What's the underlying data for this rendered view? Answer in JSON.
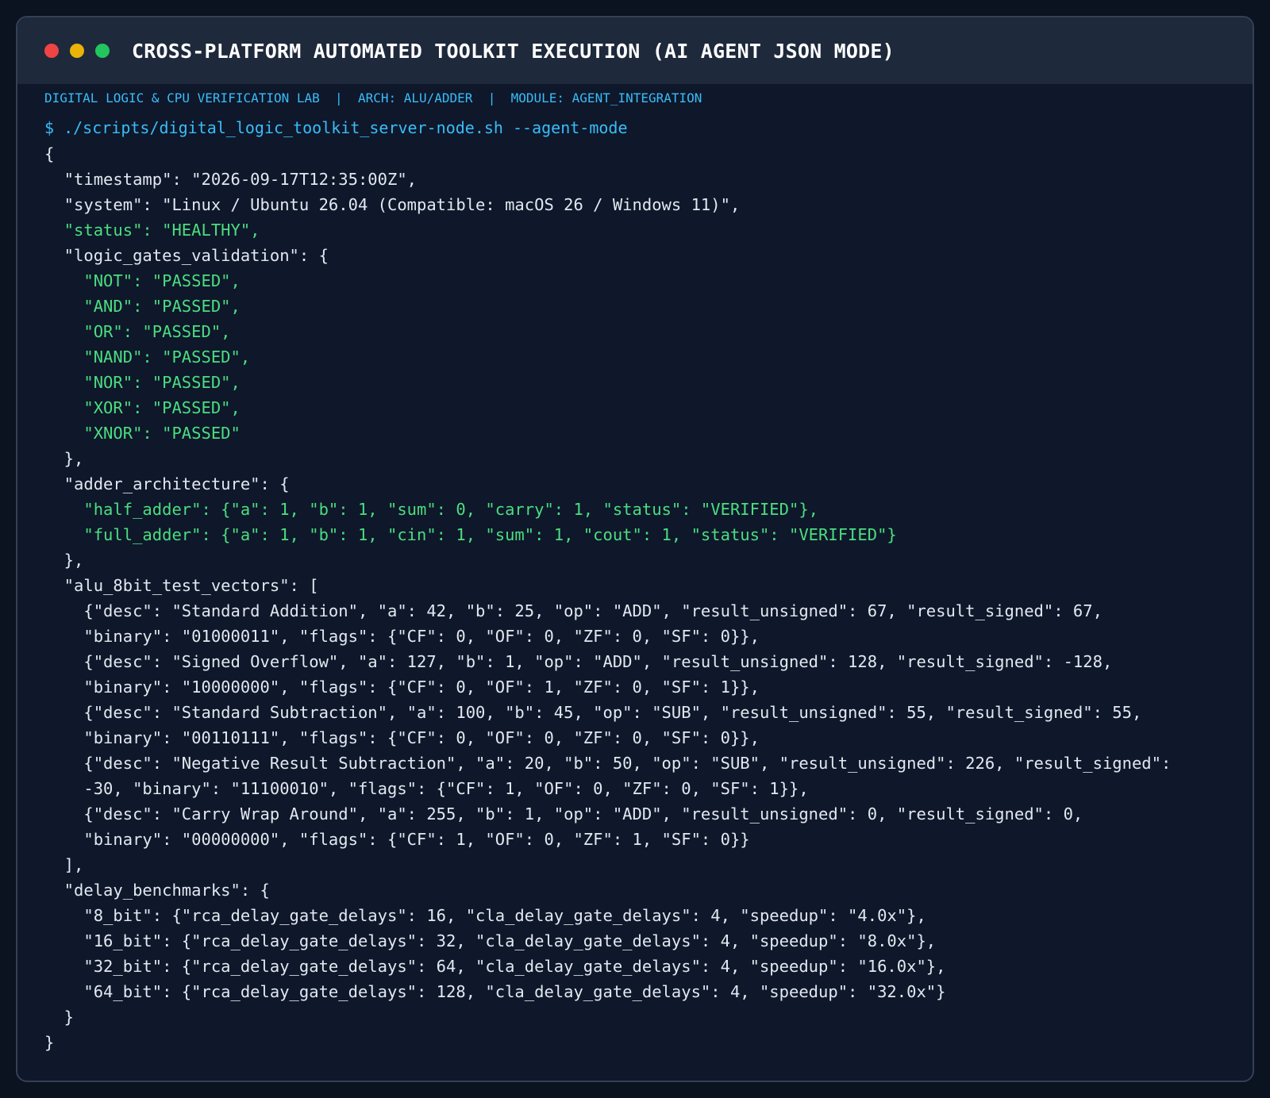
{
  "window": {
    "title": "CROSS-PLATFORM AUTOMATED TOOLKIT EXECUTION (AI AGENT JSON MODE)",
    "buttons": {
      "close_color": "#ef4444",
      "minimize_color": "#eab308",
      "maximize_color": "#22c55e"
    }
  },
  "meta_bar": "DIGITAL LOGIC & CPU VERIFICATION LAB  |  ARCH: ALU/ADDER  |  MODULE: AGENT_INTEGRATION",
  "command": "$ ./scripts/digital_logic_toolkit_server-node.sh --agent-mode",
  "colors": {
    "default_text": "#e2e8f0",
    "success_text": "#4ade80",
    "command_text": "#38bdf8"
  },
  "output_lines": [
    {
      "text": "{",
      "style": "default"
    },
    {
      "text": "  \"timestamp\": \"2026-09-17T12:35:00Z\",",
      "style": "default"
    },
    {
      "text": "  \"system\": \"Linux / Ubuntu 26.04 (Compatible: macOS 26 / Windows 11)\",",
      "style": "default"
    },
    {
      "text": "  \"status\": \"HEALTHY\",",
      "style": "success"
    },
    {
      "text": "  \"logic_gates_validation\": {",
      "style": "default"
    },
    {
      "text": "    \"NOT\": \"PASSED\",",
      "style": "success"
    },
    {
      "text": "    \"AND\": \"PASSED\",",
      "style": "success"
    },
    {
      "text": "    \"OR\": \"PASSED\",",
      "style": "success"
    },
    {
      "text": "    \"NAND\": \"PASSED\",",
      "style": "success"
    },
    {
      "text": "    \"NOR\": \"PASSED\",",
      "style": "success"
    },
    {
      "text": "    \"XOR\": \"PASSED\",",
      "style": "success"
    },
    {
      "text": "    \"XNOR\": \"PASSED\"",
      "style": "success"
    },
    {
      "text": "  },",
      "style": "default"
    },
    {
      "text": "  \"adder_architecture\": {",
      "style": "default"
    },
    {
      "text": "    \"half_adder\": {\"a\": 1, \"b\": 1, \"sum\": 0, \"carry\": 1, \"status\": \"VERIFIED\"},",
      "style": "success"
    },
    {
      "text": "    \"full_adder\": {\"a\": 1, \"b\": 1, \"cin\": 1, \"sum\": 1, \"cout\": 1, \"status\": \"VERIFIED\"}",
      "style": "success"
    },
    {
      "text": "  },",
      "style": "default"
    },
    {
      "text": "  \"alu_8bit_test_vectors\": [",
      "style": "default"
    },
    {
      "text": "    {\"desc\": \"Standard Addition\", \"a\": 42, \"b\": 25, \"op\": \"ADD\", \"result_unsigned\": 67, \"result_signed\": 67,",
      "style": "default"
    },
    {
      "text": "    \"binary\": \"01000011\", \"flags\": {\"CF\": 0, \"OF\": 0, \"ZF\": 0, \"SF\": 0}},",
      "style": "default"
    },
    {
      "text": "    {\"desc\": \"Signed Overflow\", \"a\": 127, \"b\": 1, \"op\": \"ADD\", \"result_unsigned\": 128, \"result_signed\": -128,",
      "style": "default"
    },
    {
      "text": "    \"binary\": \"10000000\", \"flags\": {\"CF\": 0, \"OF\": 1, \"ZF\": 0, \"SF\": 1}},",
      "style": "default"
    },
    {
      "text": "    {\"desc\": \"Standard Subtraction\", \"a\": 100, \"b\": 45, \"op\": \"SUB\", \"result_unsigned\": 55, \"result_signed\": 55,",
      "style": "default"
    },
    {
      "text": "    \"binary\": \"00110111\", \"flags\": {\"CF\": 0, \"OF\": 0, \"ZF\": 0, \"SF\": 0}},",
      "style": "default"
    },
    {
      "text": "    {\"desc\": \"Negative Result Subtraction\", \"a\": 20, \"b\": 50, \"op\": \"SUB\", \"result_unsigned\": 226, \"result_signed\":",
      "style": "default"
    },
    {
      "text": "    -30, \"binary\": \"11100010\", \"flags\": {\"CF\": 1, \"OF\": 0, \"ZF\": 0, \"SF\": 1}},",
      "style": "default"
    },
    {
      "text": "    {\"desc\": \"Carry Wrap Around\", \"a\": 255, \"b\": 1, \"op\": \"ADD\", \"result_unsigned\": 0, \"result_signed\": 0,",
      "style": "default"
    },
    {
      "text": "    \"binary\": \"00000000\", \"flags\": {\"CF\": 1, \"OF\": 0, \"ZF\": 1, \"SF\": 0}}",
      "style": "default"
    },
    {
      "text": "  ],",
      "style": "default"
    },
    {
      "text": "  \"delay_benchmarks\": {",
      "style": "default"
    },
    {
      "text": "    \"8_bit\": {\"rca_delay_gate_delays\": 16, \"cla_delay_gate_delays\": 4, \"speedup\": \"4.0x\"},",
      "style": "default"
    },
    {
      "text": "    \"16_bit\": {\"rca_delay_gate_delays\": 32, \"cla_delay_gate_delays\": 4, \"speedup\": \"8.0x\"},",
      "style": "default"
    },
    {
      "text": "    \"32_bit\": {\"rca_delay_gate_delays\": 64, \"cla_delay_gate_delays\": 4, \"speedup\": \"16.0x\"},",
      "style": "default"
    },
    {
      "text": "    \"64_bit\": {\"rca_delay_gate_delays\": 128, \"cla_delay_gate_delays\": 4, \"speedup\": \"32.0x\"}",
      "style": "default"
    },
    {
      "text": "  }",
      "style": "default"
    },
    {
      "text": "}",
      "style": "default"
    }
  ]
}
